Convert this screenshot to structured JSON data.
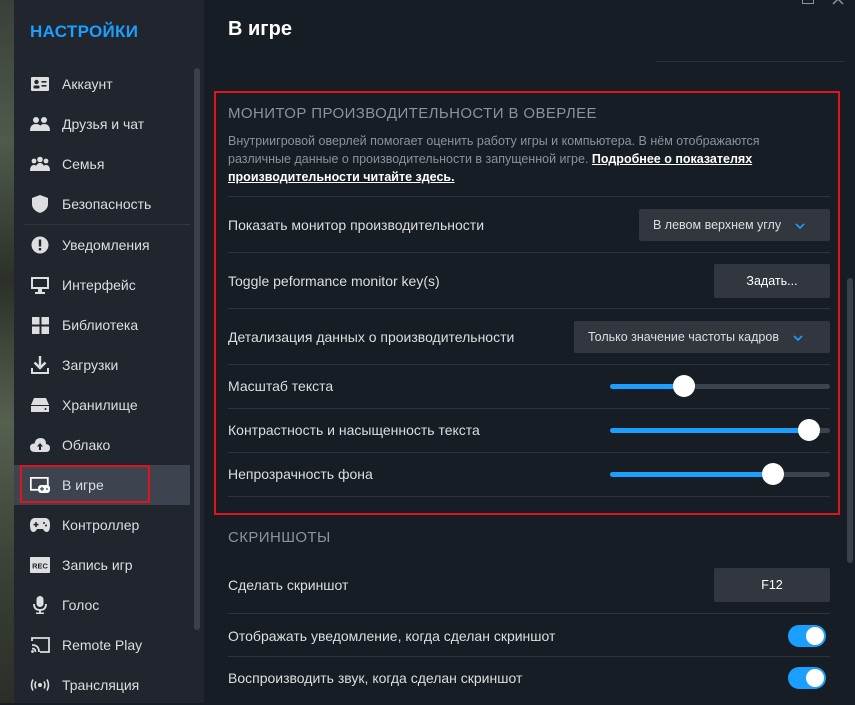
{
  "sidebar": {
    "title": "НАСТРОЙКИ",
    "items": [
      {
        "label": "Аккаунт",
        "icon": "account-card-icon"
      },
      {
        "label": "Друзья и чат",
        "icon": "friends-icon"
      },
      {
        "label": "Семья",
        "icon": "family-icon"
      },
      {
        "label": "Безопасность",
        "icon": "shield-icon"
      },
      {
        "label": "Уведомления",
        "icon": "alert-icon"
      },
      {
        "label": "Интерфейс",
        "icon": "monitor-icon"
      },
      {
        "label": "Библиотека",
        "icon": "grid-icon"
      },
      {
        "label": "Загрузки",
        "icon": "download-icon"
      },
      {
        "label": "Хранилище",
        "icon": "storage-icon"
      },
      {
        "label": "Облако",
        "icon": "cloud-icon"
      },
      {
        "label": "В игре",
        "icon": "ingame-icon",
        "active": true
      },
      {
        "label": "Контроллер",
        "icon": "gamepad-icon"
      },
      {
        "label": "Запись игр",
        "icon": "rec-icon"
      },
      {
        "label": "Голос",
        "icon": "microphone-icon"
      },
      {
        "label": "Remote Play",
        "icon": "cast-icon"
      },
      {
        "label": "Трансляция",
        "icon": "broadcast-icon"
      }
    ]
  },
  "main": {
    "title": "В игре",
    "perf": {
      "title": "МОНИТОР ПРОИЗВОДИТЕЛЬНОСТИ В ОВЕРЛЕЕ",
      "desc": "Внутриигровой оверлей помогает оценить работу игры и компьютера. В нём отображаются различные данные о производительности в запущенной игре. ",
      "desc_link": "Подробнее о показателях производительности читайте здесь.",
      "show_label": "Показать монитор производительности",
      "show_value": "В левом верхнем углу",
      "toggle_label": "Toggle peformance monitor key(s)",
      "toggle_button": "Задать...",
      "detail_label": "Детализация данных о производительности",
      "detail_value": "Только значение частоты кадров",
      "text_scale_label": "Масштаб текста",
      "text_scale_value": 0.32,
      "contrast_label": "Контрастность и насыщенность текста",
      "contrast_value": 0.95,
      "opacity_label": "Непрозрачность фона",
      "opacity_value": 0.77
    },
    "screens": {
      "title": "СКРИНШОТЫ",
      "take_label": "Сделать скриншот",
      "take_key": "F12",
      "notify_label": "Отображать уведомление, когда сделан скриншот",
      "notify_on": true,
      "sound_label": "Воспроизводить звук, когда сделан скриншот",
      "sound_on": true
    }
  },
  "colors": {
    "accent": "#1a9fff",
    "highlight": "#e3131b",
    "bg": "#171d25",
    "sidebar": "#21252e"
  }
}
